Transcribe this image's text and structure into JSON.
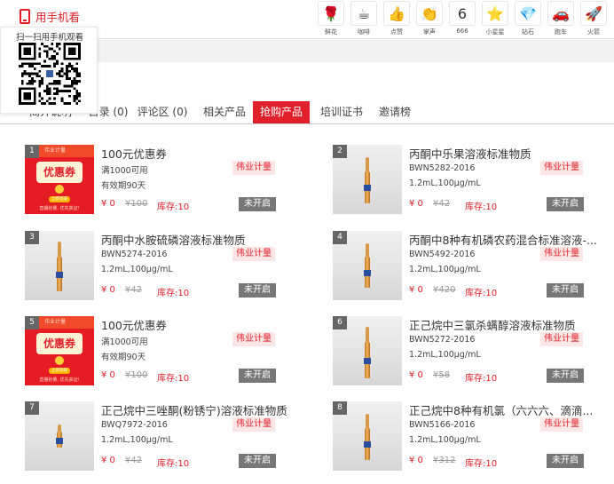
{
  "header": {
    "mobile_label": "用手机看",
    "qr_text": "扫一扫用手机观看",
    "gifts": [
      {
        "icon": "rose-icon",
        "glyph": "🌹",
        "label": "鲜花"
      },
      {
        "icon": "coffee-icon",
        "glyph": "☕",
        "label": "咖啡"
      },
      {
        "icon": "thumbs-up-icon",
        "glyph": "👍",
        "label": "点赞"
      },
      {
        "icon": "clap-icon",
        "glyph": "👏",
        "label": "掌声"
      },
      {
        "icon": "666-icon",
        "glyph": "6",
        "label": "666"
      },
      {
        "icon": "little-star-icon",
        "glyph": "⭐",
        "label": "小星星"
      },
      {
        "icon": "diamond-icon",
        "glyph": "💎",
        "label": "钻石"
      },
      {
        "icon": "sports-car-icon",
        "glyph": "🚗",
        "label": "跑车"
      },
      {
        "icon": "rocket-icon",
        "glyph": "🚀",
        "label": "火箭"
      }
    ]
  },
  "tabs": [
    {
      "label": "简介说明",
      "name": "tab-intro"
    },
    {
      "label": "目录 (0)",
      "name": "tab-catalog"
    },
    {
      "label": "评论区 (0)",
      "name": "tab-comments"
    },
    {
      "label": "相关产品",
      "name": "tab-related"
    },
    {
      "label": "抢购产品",
      "name": "tab-flash-sale",
      "active": true
    },
    {
      "label": "培训证书",
      "name": "tab-certificate"
    },
    {
      "label": "邀请榜",
      "name": "tab-invite-rank"
    }
  ],
  "colors": {
    "accent": "#e0202a",
    "status_gray": "#777777",
    "brand_tag_bg": "#fde6e6"
  },
  "products": [
    {
      "num": "1",
      "kind": "coupon",
      "title": "100元优惠券",
      "line1": "满1000可用",
      "line2": "有效期90天",
      "brand": "伟业计量",
      "price": "¥ 0",
      "orig": "¥100",
      "stock": "库存:10",
      "status": "未开启"
    },
    {
      "num": "2",
      "kind": "vial",
      "title": "丙酮中乐果溶液标准物质",
      "line1": "BWN5282-2016",
      "line2": "1.2mL,100μg/mL",
      "brand": "伟业计量",
      "price": "¥ 0",
      "orig": "¥42",
      "stock": "库存:10",
      "status": "未开启"
    },
    {
      "num": "3",
      "kind": "vial",
      "title": "丙酮中水胺硫磷溶液标准物质",
      "line1": "BWN5274-2016",
      "line2": "1.2mL,100μg/mL",
      "brand": "伟业计量",
      "price": "¥ 0",
      "orig": "¥42",
      "stock": "库存:10",
      "status": "未开启"
    },
    {
      "num": "4",
      "kind": "vial",
      "title": "丙酮中8种有机磷农药混合标准溶液-...",
      "line1": "BWN5492-2016",
      "line2": "1.2mL,100μg/mL",
      "brand": "伟业计量",
      "price": "¥ 0",
      "orig": "¥420",
      "stock": "库存:10",
      "status": "未开启"
    },
    {
      "num": "5",
      "kind": "coupon",
      "title": "100元优惠券",
      "line1": "满1000可用",
      "line2": "有效期90天",
      "brand": "伟业计量",
      "price": "¥ 0",
      "orig": "¥100",
      "stock": "库存:10",
      "status": "未开启"
    },
    {
      "num": "6",
      "kind": "vial",
      "title": "正己烷中三氯杀螨醇溶液标准物质",
      "line1": "BWN5272-2016",
      "line2": "1.2mL,100μg/mL",
      "brand": "伟业计量",
      "price": "¥ 0",
      "orig": "¥58",
      "stock": "库存:10",
      "status": "未开启"
    },
    {
      "num": "7",
      "kind": "vial",
      "title": "正己烷中三唑酮(粉锈宁)溶液标准物质",
      "line1": "BWQ7972-2016",
      "line2": "1.2mL,100μg/mL",
      "brand": "伟业计量",
      "price": "¥ 0",
      "orig": "¥42",
      "stock": "库存:10",
      "status": "未开启"
    },
    {
      "num": "8",
      "kind": "vial",
      "title": "正己烷中8种有机氯（六六六、滴滴...",
      "line1": "BWN5166-2016",
      "line2": "1.2mL,100μg/mL",
      "brand": "伟业计量",
      "price": "¥ 0",
      "orig": "¥312",
      "stock": "库存:10",
      "status": "未开启"
    }
  ],
  "coupon_art": {
    "header": "伟业计量",
    "tag": "优惠券",
    "button": "立即领取",
    "footer": "直播抢量, 优先获证!"
  }
}
